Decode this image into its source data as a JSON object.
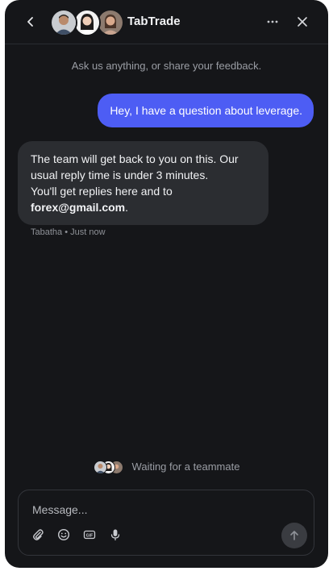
{
  "header": {
    "title": "TabTrade",
    "back_icon": "chevron-left-icon",
    "more_icon": "more-horizontal-icon",
    "close_icon": "close-icon"
  },
  "conversation": {
    "intro": "Ask us anything, or share your feedback.",
    "user_message": "Hey, I have a question about leverage.",
    "agent_message": {
      "line1": "The team will get back to you on this. Our usual reply time is under 3 minutes.",
      "line2_prefix": "You'll get replies here and to ",
      "email": "forex@gmail.com",
      "line2_suffix": "."
    },
    "agent_meta": "Tabatha • Just now"
  },
  "status": {
    "waiting_text": "Waiting for a teammate"
  },
  "composer": {
    "placeholder": "Message...",
    "tools": [
      "paperclip-icon",
      "emoji-icon",
      "gif-icon",
      "microphone-icon"
    ],
    "send_icon": "arrow-up-icon"
  },
  "colors": {
    "background": "#151619",
    "user_bubble": "#4d5df4",
    "agent_bubble": "#2b2d31",
    "muted_text": "#9a9da4"
  }
}
